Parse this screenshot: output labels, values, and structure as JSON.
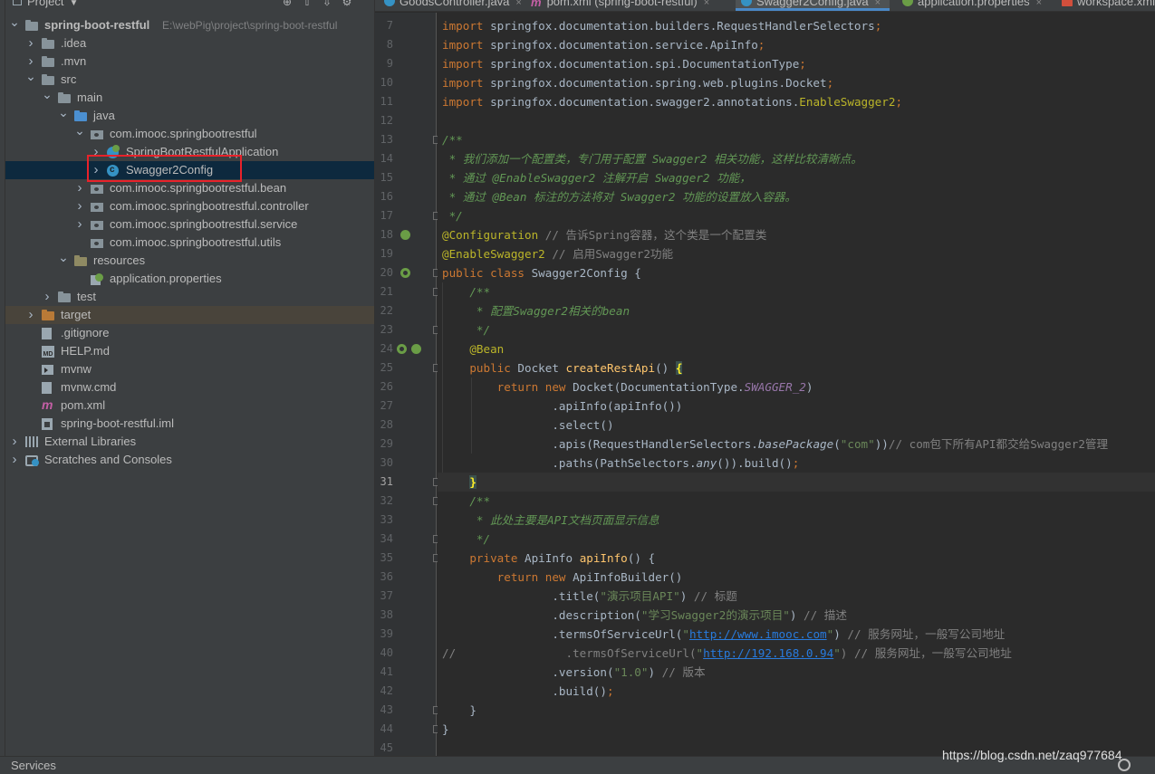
{
  "project_panel": {
    "title": "Project",
    "tree": [
      {
        "label": "spring-boot-restful",
        "path": "E:\\webPig\\project\\spring-boot-restful",
        "depth": 0,
        "arrow": "down",
        "icon": "module-folder-icon",
        "bold": true
      },
      {
        "label": ".idea",
        "depth": 1,
        "arrow": "right",
        "icon": "folder-icon"
      },
      {
        "label": ".mvn",
        "depth": 1,
        "arrow": "right",
        "icon": "folder-icon"
      },
      {
        "label": "src",
        "depth": 1,
        "arrow": "down",
        "icon": "folder-icon"
      },
      {
        "label": "main",
        "depth": 2,
        "arrow": "down",
        "icon": "folder-icon"
      },
      {
        "label": "java",
        "depth": 3,
        "arrow": "down",
        "icon": "source-folder-icon"
      },
      {
        "label": "com.imooc.springbootrestful",
        "depth": 4,
        "arrow": "down",
        "icon": "package-icon"
      },
      {
        "label": "SpringBootRestfulApplication",
        "depth": 5,
        "arrow": "right",
        "icon": "spring-boot-class-icon"
      },
      {
        "label": "Swagger2Config",
        "depth": 5,
        "arrow": "right",
        "icon": "class-icon",
        "selected": true
      },
      {
        "label": "com.imooc.springbootrestful.bean",
        "depth": 4,
        "arrow": "right",
        "icon": "package-icon"
      },
      {
        "label": "com.imooc.springbootrestful.controller",
        "depth": 4,
        "arrow": "right",
        "icon": "package-icon"
      },
      {
        "label": "com.imooc.springbootrestful.service",
        "depth": 4,
        "arrow": "right",
        "icon": "package-icon"
      },
      {
        "label": "com.imooc.springbootrestful.utils",
        "depth": 4,
        "arrow": "",
        "icon": "package-icon"
      },
      {
        "label": "resources",
        "depth": 3,
        "arrow": "down",
        "icon": "resources-folder-icon"
      },
      {
        "label": "application.properties",
        "depth": 4,
        "arrow": "",
        "icon": "spring-properties-icon"
      },
      {
        "label": "test",
        "depth": 2,
        "arrow": "right",
        "icon": "folder-icon"
      },
      {
        "label": "target",
        "depth": 1,
        "arrow": "right",
        "icon": "excluded-folder-icon",
        "excluded": true
      },
      {
        "label": ".gitignore",
        "depth": 1,
        "arrow": "",
        "icon": "text-file-icon"
      },
      {
        "label": "HELP.md",
        "depth": 1,
        "arrow": "",
        "icon": "markdown-file-icon"
      },
      {
        "label": "mvnw",
        "depth": 1,
        "arrow": "",
        "icon": "script-file-icon"
      },
      {
        "label": "mvnw.cmd",
        "depth": 1,
        "arrow": "",
        "icon": "text-file-icon"
      },
      {
        "label": "pom.xml",
        "depth": 1,
        "arrow": "",
        "icon": "maven-icon"
      },
      {
        "label": "spring-boot-restful.iml",
        "depth": 1,
        "arrow": "",
        "icon": "iml-file-icon"
      },
      {
        "label": "External Libraries",
        "depth": 0,
        "arrow": "right",
        "icon": "libraries-icon"
      },
      {
        "label": "Scratches and Consoles",
        "depth": 0,
        "arrow": "right",
        "icon": "scratches-icon"
      }
    ]
  },
  "tabs": [
    {
      "label": "GoodsController.java",
      "icon": "class-icon"
    },
    {
      "label": "pom.xml (spring-boot-restful)",
      "icon": "maven-icon"
    },
    {
      "label": "Swagger2Config.java",
      "icon": "class-icon",
      "active": true
    },
    {
      "label": "application.properties",
      "icon": "spring-properties-icon"
    },
    {
      "label": "workspace.xml",
      "icon": "xml-file-icon"
    }
  ],
  "editor": {
    "current_line": 31,
    "first_line_number": 7,
    "line_numbers": [
      "7",
      "8",
      "9",
      "10",
      "11",
      "12",
      "13",
      "14",
      "15",
      "16",
      "17",
      "18",
      "19",
      "20",
      "21",
      "22",
      "23",
      "24",
      "25",
      "26",
      "27",
      "28",
      "29",
      "30",
      "31",
      "32",
      "33",
      "34",
      "35",
      "36",
      "37",
      "38",
      "39",
      "40",
      "41",
      "42",
      "43",
      "44",
      "45"
    ],
    "lines": [
      [
        {
          "t": "import ",
          "c": "k"
        },
        {
          "t": "springfox.documentation.builders.RequestHandlerSelectors"
        },
        {
          "t": ";",
          "c": "k"
        }
      ],
      [
        {
          "t": "import ",
          "c": "k"
        },
        {
          "t": "springfox.documentation.service.ApiInfo"
        },
        {
          "t": ";",
          "c": "k"
        }
      ],
      [
        {
          "t": "import ",
          "c": "k"
        },
        {
          "t": "springfox.documentation.spi.DocumentationType"
        },
        {
          "t": ";",
          "c": "k"
        }
      ],
      [
        {
          "t": "import ",
          "c": "k"
        },
        {
          "t": "springfox.documentation.spring.web.plugins.Docket"
        },
        {
          "t": ";",
          "c": "k"
        }
      ],
      [
        {
          "t": "import ",
          "c": "k"
        },
        {
          "t": "springfox.documentation.swagger2.annotations."
        },
        {
          "t": "EnableSwagger2",
          "c": "a"
        },
        {
          "t": ";",
          "c": "k"
        }
      ],
      [],
      [
        {
          "t": "/**",
          "c": "dc"
        }
      ],
      [
        {
          "t": " * 我们添加一个配置类，专门用于配置 ",
          "c": "dc"
        },
        {
          "t": "Swagger2",
          "c": "dc"
        },
        {
          "t": " 相关功能，这样比较清晰点。",
          "c": "dc"
        }
      ],
      [
        {
          "t": " * 通过 ",
          "c": "dc"
        },
        {
          "t": "@EnableSwagger2",
          "c": "dc"
        },
        {
          "t": " 注解开启 ",
          "c": "dc"
        },
        {
          "t": "Swagger2",
          "c": "dc"
        },
        {
          "t": " 功能，",
          "c": "dc"
        }
      ],
      [
        {
          "t": " * 通过 ",
          "c": "dc"
        },
        {
          "t": "@Bean",
          "c": "dc"
        },
        {
          "t": " 标注的方法将对 ",
          "c": "dc"
        },
        {
          "t": "Swagger2",
          "c": "dc"
        },
        {
          "t": " 功能的设置放入容器。",
          "c": "dc"
        }
      ],
      [
        {
          "t": " */",
          "c": "dc"
        }
      ],
      [
        {
          "t": "@Configuration",
          "c": "a"
        },
        {
          "t": " // 告诉Spring容器，这个类是一个配置类",
          "c": "c"
        }
      ],
      [
        {
          "t": "@EnableSwagger2",
          "c": "a"
        },
        {
          "t": " // 启用Swagger2功能",
          "c": "c"
        }
      ],
      [
        {
          "t": "public class ",
          "c": "k"
        },
        {
          "t": "Swagger2Config {"
        }
      ],
      [
        {
          "t": "    /**",
          "c": "dc"
        }
      ],
      [
        {
          "t": "     * 配置Swagger2相关的bean",
          "c": "dc"
        }
      ],
      [
        {
          "t": "     */",
          "c": "dc"
        }
      ],
      [
        {
          "t": "    "
        },
        {
          "t": "@Bean",
          "c": "a"
        }
      ],
      [
        {
          "t": "    "
        },
        {
          "t": "public ",
          "c": "k"
        },
        {
          "t": "Docket "
        },
        {
          "t": "createRestApi",
          "c": "fn"
        },
        {
          "t": "() "
        },
        {
          "t": "{",
          "c": "brace"
        }
      ],
      [
        {
          "t": "        "
        },
        {
          "t": "return new ",
          "c": "k"
        },
        {
          "t": "Docket(DocumentationType."
        },
        {
          "t": "SWAGGER_2",
          "c": "st"
        },
        {
          "t": ")"
        }
      ],
      [
        {
          "t": "                .apiInfo(apiInfo())"
        }
      ],
      [
        {
          "t": "                .select()"
        }
      ],
      [
        {
          "t": "                .apis(RequestHandlerSelectors."
        },
        {
          "t": "basePackage",
          "c": "it"
        },
        {
          "t": "("
        },
        {
          "t": "\"com\"",
          "c": "s"
        },
        {
          "t": "))"
        },
        {
          "t": "// com包下所有API都交给Swagger2管理",
          "c": "c"
        }
      ],
      [
        {
          "t": "                .paths(PathSelectors."
        },
        {
          "t": "any",
          "c": "it"
        },
        {
          "t": "()).build()"
        },
        {
          "t": ";",
          "c": "k"
        }
      ],
      [
        {
          "t": "    "
        },
        {
          "t": "}",
          "c": "brace"
        }
      ],
      [
        {
          "t": "    /**",
          "c": "dc"
        }
      ],
      [
        {
          "t": "     * 此处主要是API文档页面显示信息",
          "c": "dc"
        }
      ],
      [
        {
          "t": "     */",
          "c": "dc"
        }
      ],
      [
        {
          "t": "    "
        },
        {
          "t": "private ",
          "c": "k"
        },
        {
          "t": "ApiInfo "
        },
        {
          "t": "apiInfo",
          "c": "fn"
        },
        {
          "t": "() {"
        }
      ],
      [
        {
          "t": "        "
        },
        {
          "t": "return new ",
          "c": "k"
        },
        {
          "t": "ApiInfoBuilder()"
        }
      ],
      [
        {
          "t": "                .title("
        },
        {
          "t": "\"演示项目API\"",
          "c": "s"
        },
        {
          "t": ") "
        },
        {
          "t": "// 标题",
          "c": "c"
        }
      ],
      [
        {
          "t": "                .description("
        },
        {
          "t": "\"学习Swagger2的演示项目\"",
          "c": "s"
        },
        {
          "t": ") "
        },
        {
          "t": "// 描述",
          "c": "c"
        }
      ],
      [
        {
          "t": "                .termsOfServiceUrl("
        },
        {
          "t": "\"",
          "c": "s"
        },
        {
          "t": "http://www.imooc.com",
          "c": "u"
        },
        {
          "t": "\"",
          "c": "s"
        },
        {
          "t": ") "
        },
        {
          "t": "// 服务网址，一般写公司地址",
          "c": "c"
        }
      ],
      [
        {
          "t": "//",
          "c": "c"
        },
        {
          "t": "                .termsOfServiceUrl(",
          "c": "c"
        },
        {
          "t": "\"",
          "c": "s"
        },
        {
          "t": "http://192.168.0.94",
          "c": "u"
        },
        {
          "t": "\"",
          "c": "s"
        },
        {
          "t": ") // 服务网址，一般写公司地址",
          "c": "c"
        }
      ],
      [
        {
          "t": "                .version("
        },
        {
          "t": "\"1.0\"",
          "c": "s"
        },
        {
          "t": ") "
        },
        {
          "t": "// 版本",
          "c": "c"
        }
      ],
      [
        {
          "t": "                .build()"
        },
        {
          "t": ";",
          "c": "k"
        }
      ],
      [
        {
          "t": "    }"
        }
      ],
      [
        {
          "t": "}"
        }
      ],
      []
    ]
  },
  "bottom_bar": {
    "services_label": "Services"
  },
  "watermark": "https://blog.csdn.net/zaq977684"
}
